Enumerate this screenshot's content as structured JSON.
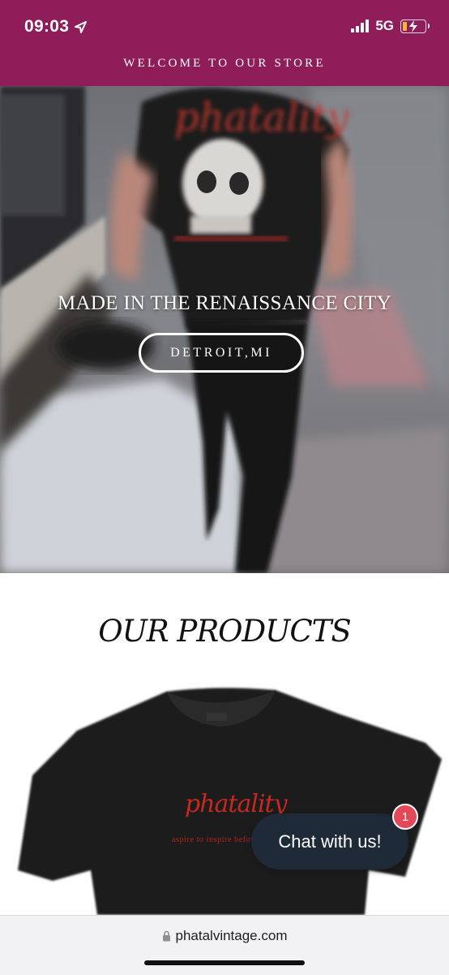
{
  "status_bar": {
    "time": "09:03",
    "network": "5G",
    "icons": [
      "location-arrow-icon",
      "signal-bars-icon",
      "battery-charging-icon"
    ]
  },
  "announcement": {
    "text": "WELCOME TO OUR STORE"
  },
  "hero": {
    "title": "MADE IN THE RENAISSANCE CITY",
    "button_label": "DETROIT,MI",
    "brand_on_shirt": "phatality"
  },
  "products": {
    "title": "OUR PRODUCTS",
    "shirt_brand": "phatality",
    "shirt_tagline": "aspire to inspire before"
  },
  "chat": {
    "label": "Chat with us!",
    "badge_count": "1"
  },
  "browser": {
    "url": "phatalvintage.com",
    "icons": [
      "lock-icon"
    ]
  },
  "colors": {
    "brand": "#8f1d5a",
    "chat_bg": "#1f2a38",
    "badge": "#e24857",
    "shirt_print": "#c7281f"
  }
}
